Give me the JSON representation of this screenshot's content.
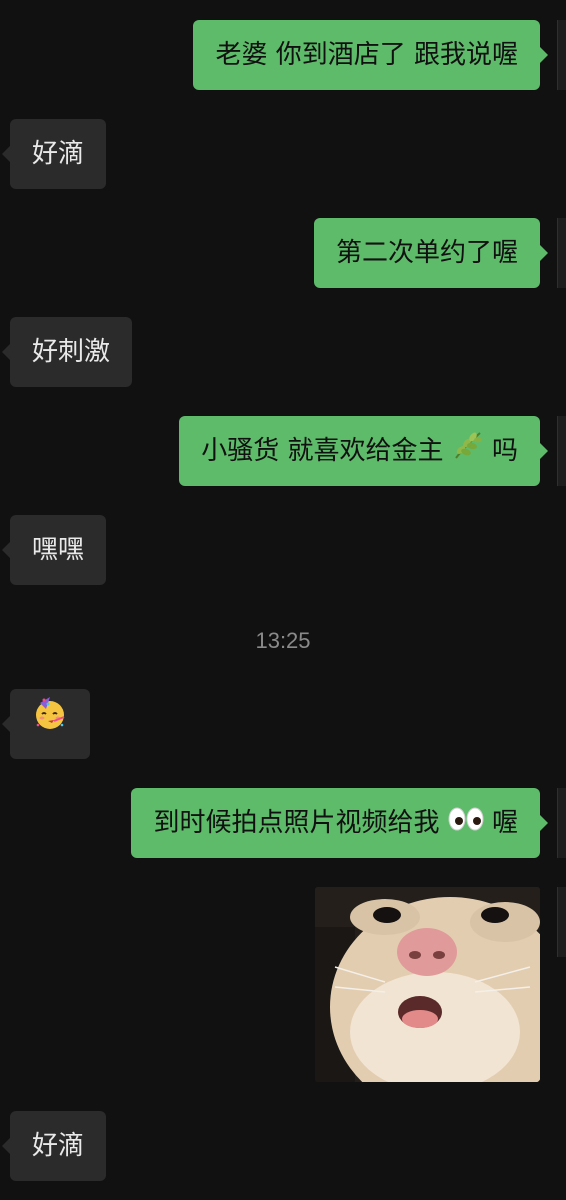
{
  "chat": {
    "timestamp": "13:25",
    "messages": [
      {
        "side": "right",
        "text": "老婆 你到酒店了 跟我说喔"
      },
      {
        "side": "left",
        "text": "好滴"
      },
      {
        "side": "right",
        "text": "第二次单约了喔"
      },
      {
        "side": "left",
        "text": "好刺激"
      },
      {
        "side": "right",
        "text_before": "小骚货 就喜欢给金主",
        "emoji": "herb-emoji",
        "text_after": "吗"
      },
      {
        "side": "left",
        "text": "嘿嘿"
      },
      {
        "side": "left",
        "emoji": "partying-face-emoji"
      },
      {
        "side": "right",
        "text_before": "到时候拍点照片视频给我",
        "emoji": "eyes-emoji",
        "text_after": "喔"
      },
      {
        "side": "right",
        "image": "cat-face-photo"
      },
      {
        "side": "left",
        "text": "好滴"
      }
    ]
  },
  "colors": {
    "background": "#111111",
    "outgoing_bubble": "#5dbb6a",
    "incoming_bubble": "#2b2b2b",
    "timestamp_text": "#8a8a8a"
  }
}
